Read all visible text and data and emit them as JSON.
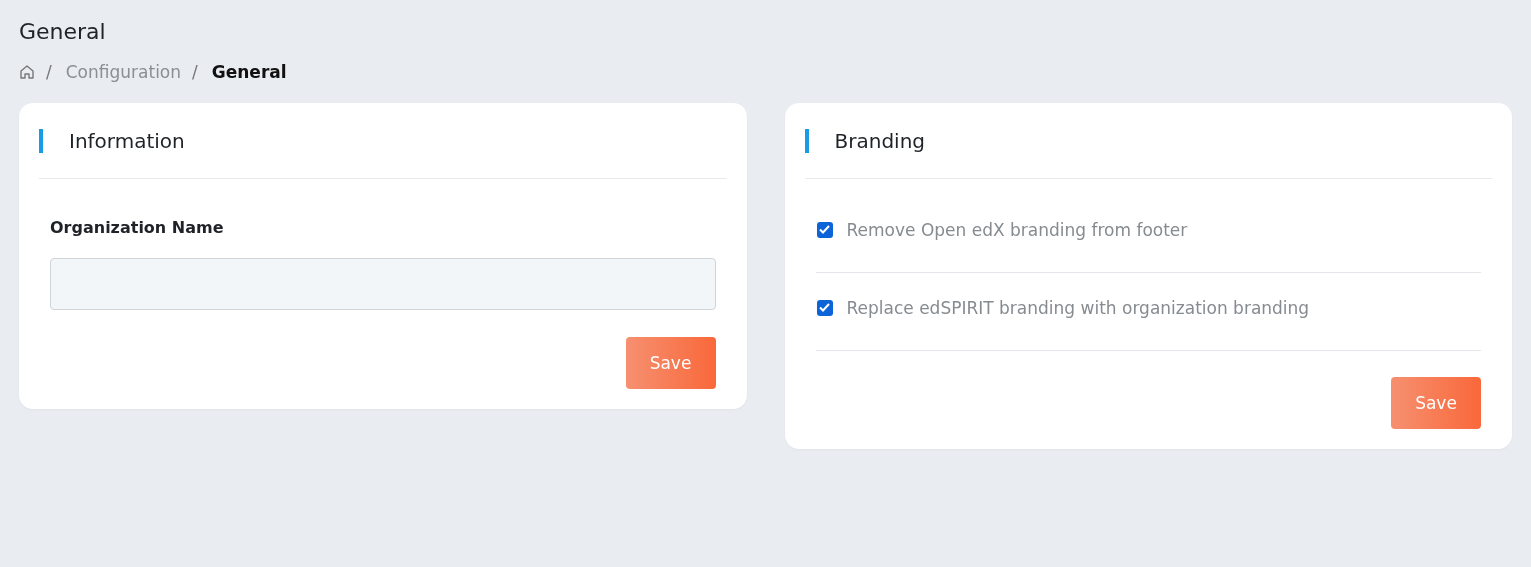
{
  "page": {
    "title": "General"
  },
  "breadcrumb": {
    "separator": "/",
    "items": [
      {
        "kind": "home"
      },
      {
        "kind": "link",
        "label": "Configuration"
      },
      {
        "kind": "current",
        "label": "General"
      }
    ]
  },
  "cards": [
    {
      "kind": "form",
      "title": "Information",
      "fields": [
        {
          "label": "Organization Name"
        }
      ],
      "button": "Save"
    },
    {
      "kind": "options",
      "title": "Branding",
      "options": [
        {
          "label": "Remove Open edX branding from footer",
          "checked": true
        },
        {
          "label": "Replace edSPIRIT branding with organization branding",
          "checked": true
        }
      ],
      "button": "Save"
    }
  ]
}
